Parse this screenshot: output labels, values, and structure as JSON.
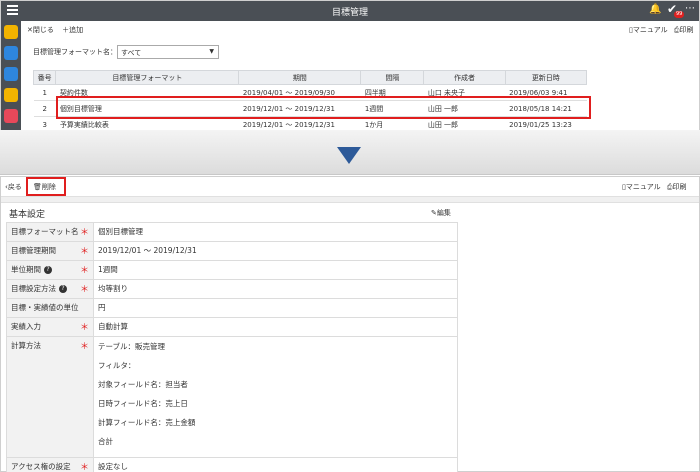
{
  "top": {
    "title": "目標管理",
    "badge": "99",
    "toolbar": {
      "close": "✕閉じる",
      "add": "＋追加"
    },
    "links": {
      "manual": "マニュアル",
      "print": "印刷"
    },
    "filter_label": "目標管理フォーマット名：",
    "filter_value": "すべて",
    "columns": [
      "番号",
      "目標管理フォーマット",
      "期間",
      "間隔",
      "作成者",
      "更新日時"
    ],
    "rows": [
      [
        "1",
        "契約件数",
        "2019/04/01 ～ 2019/09/30",
        "四半期",
        "山口 未央子",
        "2019/06/03 9:41"
      ],
      [
        "2",
        "個別目標管理",
        "2019/12/01 ～ 2019/12/31",
        "1週間",
        "山田 一郎",
        "2018/05/18 14:21"
      ],
      [
        "3",
        "予算実績比較表",
        "2019/12/01 ～ 2019/12/31",
        "1か月",
        "山田 一郎",
        "2019/01/25 13:23"
      ]
    ],
    "sidebar_colors": [
      "#f3b400",
      "#2e86de",
      "#2e86de",
      "#f3b400",
      "#e8485a"
    ]
  },
  "bottom": {
    "back": "戻る",
    "delete": "削除",
    "links": {
      "manual": "マニュアル",
      "print": "印刷"
    },
    "section": "基本設定",
    "edit": "編集",
    "fields": [
      {
        "label": "目標フォーマット名",
        "value": "個別目標管理",
        "required": true,
        "help": false
      },
      {
        "label": "目標管理期間",
        "value": "2019/12/01 ～ 2019/12/31",
        "required": true,
        "help": false
      },
      {
        "label": "単位期間",
        "value": "1週間",
        "required": true,
        "help": true
      },
      {
        "label": "目標設定方法",
        "value": "均等割り",
        "required": true,
        "help": true
      },
      {
        "label": "目標・実績値の単位",
        "value": "円",
        "required": false,
        "help": false
      },
      {
        "label": "実績入力",
        "value": "自動計算",
        "required": true,
        "help": false
      }
    ],
    "calc": {
      "label": "計算方法",
      "lines": [
        "テーブル：販売管理",
        "フィルタ：",
        "対象フィールド名：担当者",
        "日時フィールド名：売上日",
        "計算フィールド名：売上金額",
        "合計"
      ]
    },
    "access": {
      "label": "アクセス権の設定",
      "value": "設定なし"
    }
  }
}
